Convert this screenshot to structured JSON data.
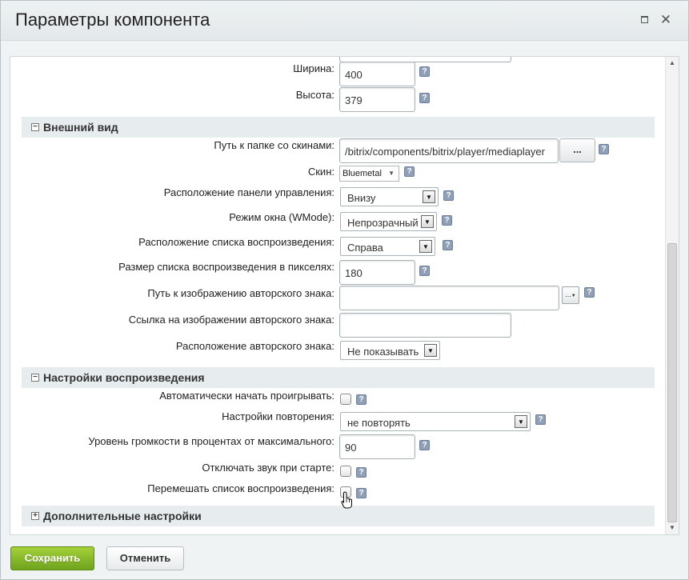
{
  "dialog": {
    "title": "Параметры компонента",
    "maximize_icon": "maximize-icon",
    "close_icon": "close-icon",
    "close_glyph": "✕"
  },
  "fields_top": {
    "width_label": "Ширина:",
    "width_value": "400",
    "height_label": "Высота:",
    "height_value": "379"
  },
  "sections": {
    "appearance": "Внешний вид",
    "playback": "Настройки воспроизведения",
    "additional": "Дополнительные настройки"
  },
  "toggle": {
    "minus": "−",
    "plus": "+"
  },
  "appearance": {
    "skin_path_label": "Путь к папке со скинами:",
    "skin_path_value": "/bitrix/components/bitrix/player/mediaplayer",
    "browse_label": "...",
    "skin_label": "Скин:",
    "skin_value": "Bluemetal",
    "control_panel_label": "Расположение панели управления:",
    "control_panel_value": "Внизу",
    "wmode_label": "Режим окна (WMode):",
    "wmode_value": "Непрозрачный",
    "playlist_pos_label": "Расположение списка воспроизведения:",
    "playlist_pos_value": "Справа",
    "playlist_size_label": "Размер списка воспроизведения в пикселях:",
    "playlist_size_value": "180",
    "logo_path_label": "Путь к изображению авторского знака:",
    "logo_path_value": "",
    "logo_link_label": "Ссылка на изображении авторского знака:",
    "logo_link_value": "",
    "logo_pos_label": "Расположение авторского знака:",
    "logo_pos_value": "Не показывать"
  },
  "playback": {
    "autostart_label": "Автоматически начать проигрывать:",
    "repeat_label": "Настройки повторения:",
    "repeat_value": "не повторять",
    "volume_label": "Уровень громкости в процентах от максимального:",
    "volume_value": "90",
    "mute_label": "Отключать звук при старте:",
    "shuffle_label": "Перемешать список воспроизведения:"
  },
  "help_glyph": "?",
  "arrows": {
    "dropdown": "▼",
    "up": "▲",
    "down": "▼"
  },
  "footer": {
    "save_label": "Сохранить",
    "cancel_label": "Отменить"
  }
}
